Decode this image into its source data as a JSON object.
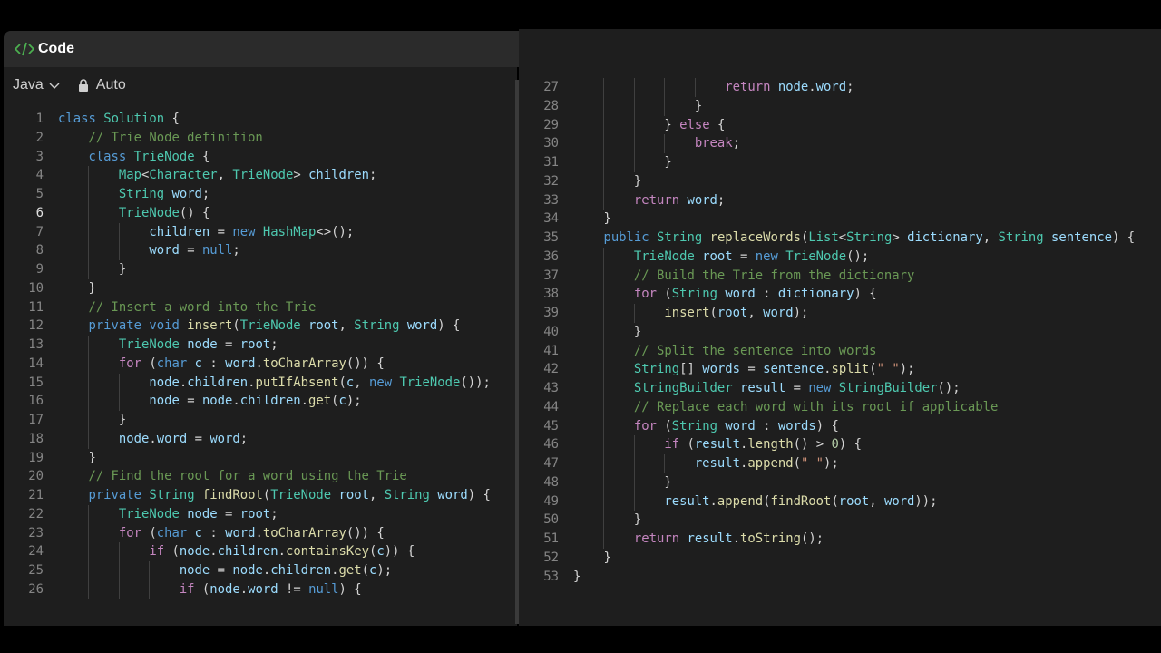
{
  "header": {
    "title": "Code",
    "icon": "code-icon"
  },
  "toolbar": {
    "language": "Java",
    "mode": "Auto"
  },
  "editor": {
    "active_line": 6,
    "left_lines": [
      {
        "n": 1,
        "t": "class Solution {",
        "indent": 0
      },
      {
        "n": 2,
        "t": "    // Trie Node definition",
        "indent": 1
      },
      {
        "n": 3,
        "t": "    class TrieNode {",
        "indent": 1
      },
      {
        "n": 4,
        "t": "        Map<Character, TrieNode> children;",
        "indent": 2
      },
      {
        "n": 5,
        "t": "        String word;",
        "indent": 2
      },
      {
        "n": 6,
        "t": "        TrieNode() {",
        "indent": 2
      },
      {
        "n": 7,
        "t": "            children = new HashMap<>();",
        "indent": 3
      },
      {
        "n": 8,
        "t": "            word = null;",
        "indent": 3
      },
      {
        "n": 9,
        "t": "        }",
        "indent": 2
      },
      {
        "n": 10,
        "t": "    }",
        "indent": 1
      },
      {
        "n": 11,
        "t": "    // Insert a word into the Trie",
        "indent": 1
      },
      {
        "n": 12,
        "t": "    private void insert(TrieNode root, String word) {",
        "indent": 1
      },
      {
        "n": 13,
        "t": "        TrieNode node = root;",
        "indent": 2
      },
      {
        "n": 14,
        "t": "        for (char c : word.toCharArray()) {",
        "indent": 2
      },
      {
        "n": 15,
        "t": "            node.children.putIfAbsent(c, new TrieNode());",
        "indent": 3
      },
      {
        "n": 16,
        "t": "            node = node.children.get(c);",
        "indent": 3
      },
      {
        "n": 17,
        "t": "        }",
        "indent": 2
      },
      {
        "n": 18,
        "t": "        node.word = word;",
        "indent": 2
      },
      {
        "n": 19,
        "t": "    }",
        "indent": 1
      },
      {
        "n": 20,
        "t": "    // Find the root for a word using the Trie",
        "indent": 1
      },
      {
        "n": 21,
        "t": "    private String findRoot(TrieNode root, String word) {",
        "indent": 1
      },
      {
        "n": 22,
        "t": "        TrieNode node = root;",
        "indent": 2
      },
      {
        "n": 23,
        "t": "        for (char c : word.toCharArray()) {",
        "indent": 2
      },
      {
        "n": 24,
        "t": "            if (node.children.containsKey(c)) {",
        "indent": 3
      },
      {
        "n": 25,
        "t": "                node = node.children.get(c);",
        "indent": 4
      },
      {
        "n": 26,
        "t": "                if (node.word != null) {",
        "indent": 4
      }
    ],
    "right_lines": [
      {
        "n": 27,
        "t": "                    return node.word;",
        "indent": 5
      },
      {
        "n": 28,
        "t": "                }",
        "indent": 4
      },
      {
        "n": 29,
        "t": "            } else {",
        "indent": 3
      },
      {
        "n": 30,
        "t": "                break;",
        "indent": 4
      },
      {
        "n": 31,
        "t": "            }",
        "indent": 3
      },
      {
        "n": 32,
        "t": "        }",
        "indent": 2
      },
      {
        "n": 33,
        "t": "        return word;",
        "indent": 2
      },
      {
        "n": 34,
        "t": "    }",
        "indent": 1
      },
      {
        "n": 35,
        "t": "    public String replaceWords(List<String> dictionary, String sentence) {",
        "indent": 1
      },
      {
        "n": 36,
        "t": "        TrieNode root = new TrieNode();",
        "indent": 2
      },
      {
        "n": 37,
        "t": "        // Build the Trie from the dictionary",
        "indent": 2
      },
      {
        "n": 38,
        "t": "        for (String word : dictionary) {",
        "indent": 2
      },
      {
        "n": 39,
        "t": "            insert(root, word);",
        "indent": 3
      },
      {
        "n": 40,
        "t": "        }",
        "indent": 2
      },
      {
        "n": 41,
        "t": "        // Split the sentence into words",
        "indent": 2
      },
      {
        "n": 42,
        "t": "        String[] words = sentence.split(\" \");",
        "indent": 2
      },
      {
        "n": 43,
        "t": "        StringBuilder result = new StringBuilder();",
        "indent": 2
      },
      {
        "n": 44,
        "t": "        // Replace each word with its root if applicable",
        "indent": 2
      },
      {
        "n": 45,
        "t": "        for (String word : words) {",
        "indent": 2
      },
      {
        "n": 46,
        "t": "            if (result.length() > 0) {",
        "indent": 3
      },
      {
        "n": 47,
        "t": "                result.append(\" \");",
        "indent": 4
      },
      {
        "n": 48,
        "t": "            }",
        "indent": 3
      },
      {
        "n": 49,
        "t": "            result.append(findRoot(root, word));",
        "indent": 3
      },
      {
        "n": 50,
        "t": "        }",
        "indent": 2
      },
      {
        "n": 51,
        "t": "        return result.toString();",
        "indent": 2
      },
      {
        "n": 52,
        "t": "    }",
        "indent": 1
      },
      {
        "n": 53,
        "t": "}",
        "indent": 0
      }
    ]
  },
  "colors": {
    "keyword": "#569cd6",
    "type": "#4ec9b0",
    "comment": "#6a9955",
    "control": "#c586c0",
    "function": "#dcdcaa",
    "variable": "#9cdcfe",
    "string": "#ce9178",
    "number": "#b5cea8",
    "background": "#1e1e1e"
  }
}
